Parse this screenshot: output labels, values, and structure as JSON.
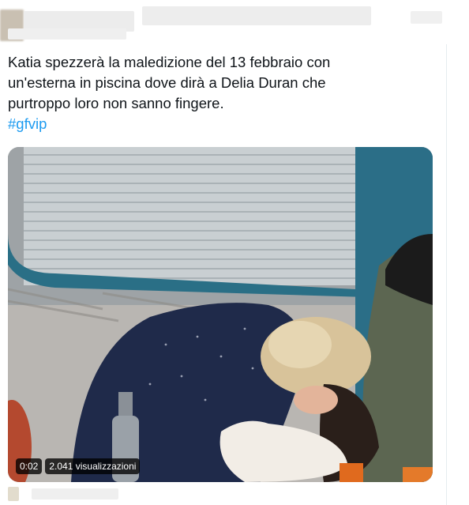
{
  "tweet": {
    "lines": [
      "Katia spezzerà la maledizione del 13 febbraio con",
      "un'esterna in piscina dove dirà a Delia Duran che",
      "purtroppo loro non sanno fingere."
    ],
    "hashtag": "#gfvip"
  },
  "video": {
    "timestamp": "0:02",
    "views": "2.041 visualizzazioni"
  },
  "colors": {
    "link": "#1d9bf0",
    "text": "#0f1419"
  }
}
